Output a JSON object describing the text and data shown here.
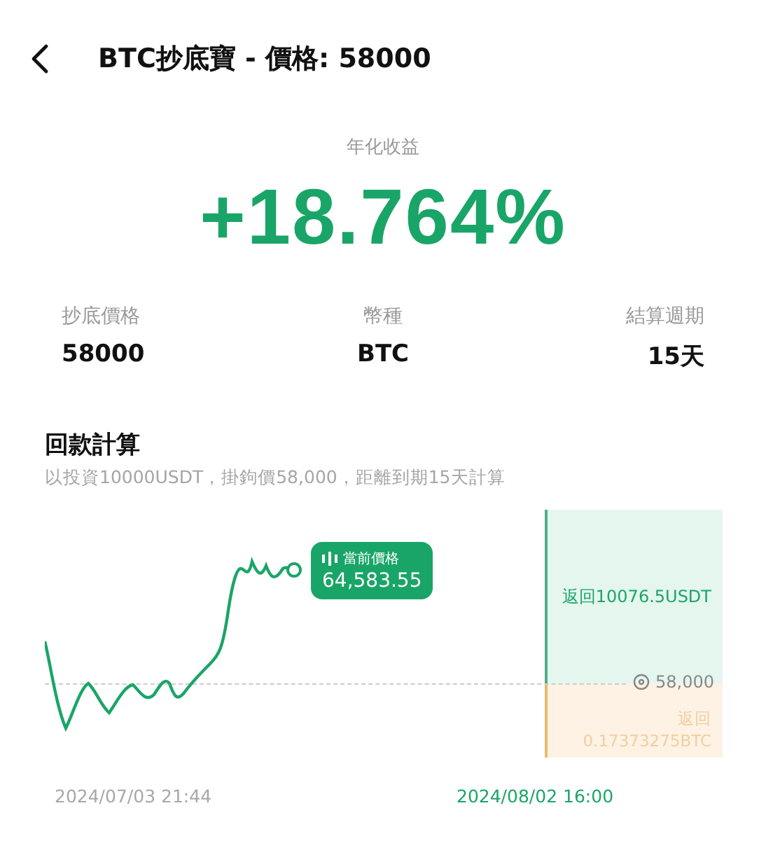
{
  "header": {
    "title": "BTC抄底寶 - 價格: 58000"
  },
  "hero": {
    "label": "年化收益",
    "value": "+18.764%"
  },
  "stats": [
    {
      "label": "抄底價格",
      "value": "58000"
    },
    {
      "label": "幣種",
      "value": "BTC"
    },
    {
      "label": "結算週期",
      "value": "15天"
    }
  ],
  "refund": {
    "title": "回款計算",
    "subtitle": "以投資10000USDT，掛鉤價58,000，距離到期15天計算",
    "chart": {
      "current_price_label": "當前價格",
      "current_price": "64,583.55",
      "strike": "58,000",
      "upper_return": "返回10076.5USDT",
      "lower_return": [
        "返回",
        "0.17373275BTC"
      ],
      "start_time": "2024/07/03 21:44",
      "end_time": "2024/08/02 16:00"
    }
  }
}
